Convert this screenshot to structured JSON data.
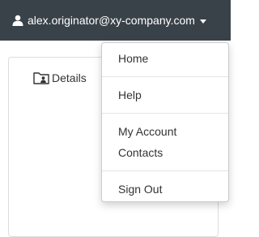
{
  "header": {
    "user_email": "alex.originator@xy-company.com",
    "user_icon": "user-icon",
    "caret_icon": "caret-down-icon"
  },
  "tabs": {
    "details_label": "Details",
    "details_icon": "folder-user-icon"
  },
  "user_menu": {
    "items": [
      {
        "label": "Home"
      },
      {
        "label": "Help"
      },
      {
        "label": "My Account"
      },
      {
        "label": "Contacts"
      },
      {
        "label": "Sign Out"
      }
    ]
  },
  "colors": {
    "topbar_background": "#3a4249",
    "menu_text": "#333333",
    "divider": "#e5e5e5"
  }
}
